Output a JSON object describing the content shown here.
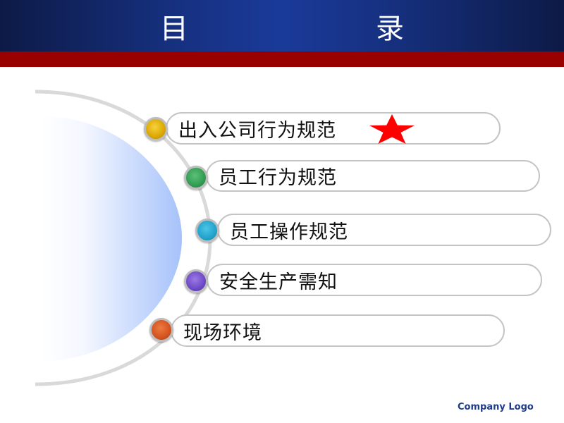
{
  "header": {
    "title": "目　　录",
    "colors": {
      "banner": "#1a3a99",
      "stripe": "#990000"
    }
  },
  "toc": {
    "items": [
      {
        "label": "出入公司行为规范",
        "bullet_color": "#e6b800",
        "marked": true,
        "marker_icon": "star-icon"
      },
      {
        "label": "员工行为规范",
        "bullet_color": "#2e9a4e",
        "marked": false
      },
      {
        "label": "员工操作规范",
        "bullet_color": "#1fa0c8",
        "marked": false
      },
      {
        "label": "安全生产需知",
        "bullet_color": "#6a45c4",
        "marked": false
      },
      {
        "label": "现场环境",
        "bullet_color": "#d0501a",
        "marked": false
      }
    ],
    "star_color": "#ff0000"
  },
  "footer": {
    "logo_text": "Company Logo"
  }
}
